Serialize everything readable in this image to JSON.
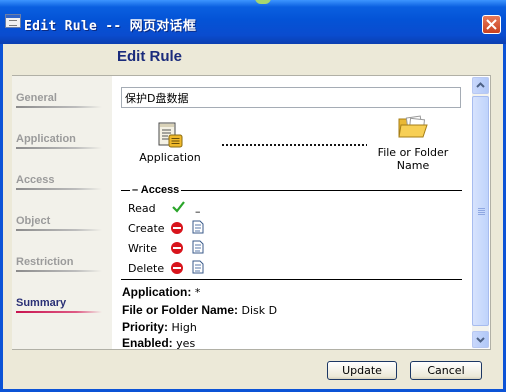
{
  "window": {
    "title": "Edit Rule -- 网页对话框"
  },
  "page": {
    "heading": "Edit Rule"
  },
  "nav": {
    "items": [
      {
        "label": "General",
        "active": false
      },
      {
        "label": "Application",
        "active": false
      },
      {
        "label": "Access",
        "active": false
      },
      {
        "label": "Object",
        "active": false
      },
      {
        "label": "Restriction",
        "active": false
      },
      {
        "label": "Summary",
        "active": true
      }
    ]
  },
  "rule": {
    "name_value": "保护D盘数据"
  },
  "diagram": {
    "source_label": "Application",
    "target_label_line1": "File or Folder",
    "target_label_line2": "Name"
  },
  "access": {
    "title": "Access",
    "permissions": [
      {
        "label": "Read",
        "icon": "check-icon",
        "extra": "–"
      },
      {
        "label": "Create",
        "icon": "deny-icon",
        "doc_icon": "document-icon"
      },
      {
        "label": "Write",
        "icon": "deny-icon",
        "doc_icon": "document-icon"
      },
      {
        "label": "Delete",
        "icon": "deny-icon",
        "doc_icon": "document-icon"
      }
    ]
  },
  "summary": {
    "application_label": "Application:",
    "application_value": "*",
    "object_label": "File or Folder Name:",
    "object_value": "Disk D",
    "priority_label": "Priority:",
    "priority_value": "High",
    "enabled_label": "Enabled:",
    "enabled_value": "yes"
  },
  "buttons": {
    "update": "Update",
    "cancel": "Cancel"
  },
  "colors": {
    "title_bar": "#0a5fe0",
    "heading": "#1a2b7c",
    "active_nav_underline": "#c8134f",
    "deny": "#d8141c",
    "check": "#2aa52a"
  }
}
